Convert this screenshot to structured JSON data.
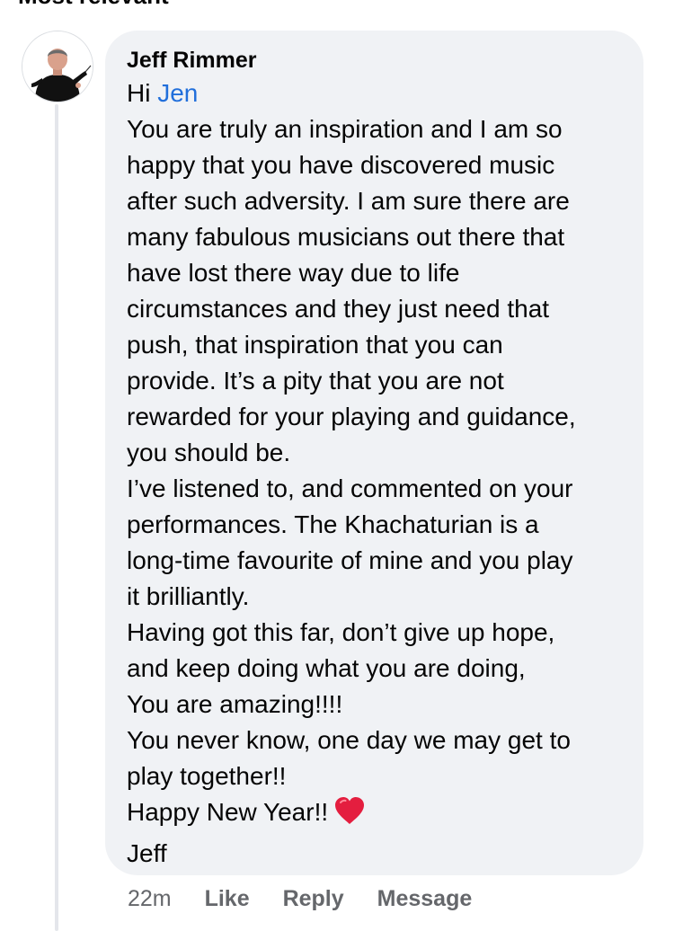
{
  "header": {
    "cut_text": "Most relevant"
  },
  "comment": {
    "author": "Jeff Rimmer",
    "avatar_icon": "person-conductor-avatar",
    "greeting_prefix": "Hi ",
    "mention": "Jen",
    "lines": [
      "You are truly an inspiration and I am so",
      "happy that you have discovered music",
      "after such adversity. I am sure there are",
      "many fabulous musicians out there that",
      "have lost there way due to life",
      "circumstances and they just need that",
      "push, that inspiration that you can",
      "provide. It’s a pity that you are not",
      "rewarded for your playing and guidance,",
      "you should be.",
      "I’ve listened to, and commented on your",
      "performances. The Khachaturian is a",
      "long-time favourite of mine and you play",
      "it brilliantly.",
      "Having got this far, don’t give up hope,",
      "and keep doing what you are doing,",
      "You are amazing!!!!",
      "You never know, one day we may get to",
      "play together!!"
    ],
    "new_year_line": "Happy New Year!!",
    "new_year_emoji": "red-heart-icon",
    "signoff": "Jeff"
  },
  "actions": {
    "timestamp": "22m",
    "like": "Like",
    "reply": "Reply",
    "message": "Message"
  },
  "colors": {
    "bubble": "#f0f2f5",
    "mention": "#216fdb",
    "meta": "#65676b",
    "heart": "#e41e3f"
  }
}
